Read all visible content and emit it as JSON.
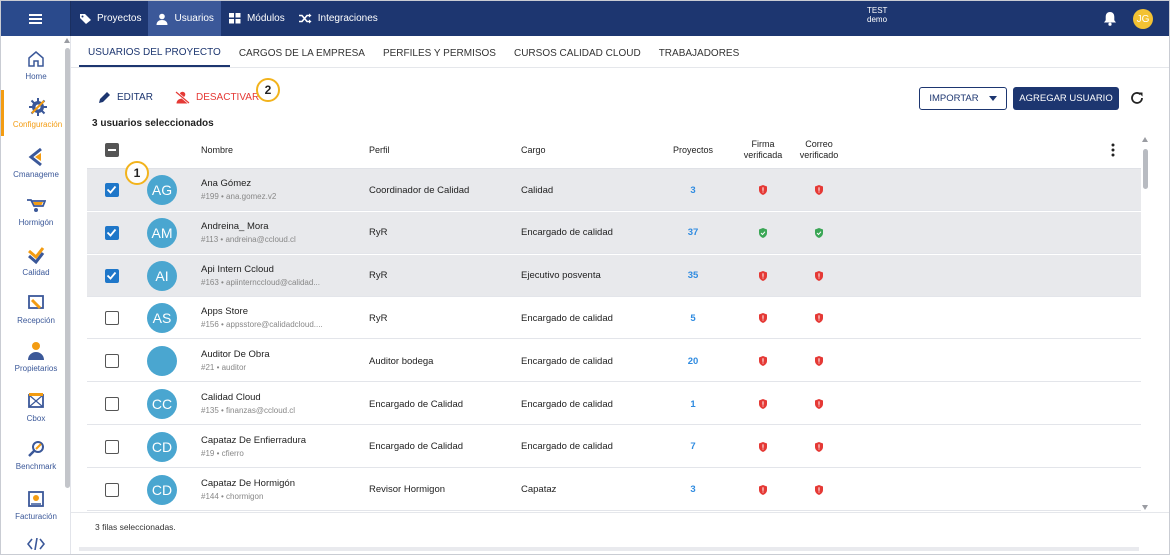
{
  "topbar": {
    "tabs": [
      {
        "label": "Proyectos",
        "icon": "tag-icon"
      },
      {
        "label": "Usuarios",
        "icon": "user-icon"
      },
      {
        "label": "Módulos",
        "icon": "grid-icon"
      },
      {
        "label": "Integraciones",
        "icon": "shuffle-icon"
      }
    ],
    "active_tab": "Usuarios",
    "env_line1": "TEST",
    "env_line2": "demo",
    "user_initials": "JG"
  },
  "sidebar": {
    "items": [
      {
        "label": "Home",
        "icon": "home-icon"
      },
      {
        "label": "Configuración",
        "icon": "settings-icon",
        "active": true
      },
      {
        "label": "Cmanageme",
        "icon": "cmanagement-icon"
      },
      {
        "label": "Hormigón",
        "icon": "wheelbarrow-icon"
      },
      {
        "label": "Calidad",
        "icon": "quality-check-icon"
      },
      {
        "label": "Recepción",
        "icon": "reception-icon"
      },
      {
        "label": "Propietarios",
        "icon": "owners-icon"
      },
      {
        "label": "Cbox",
        "icon": "cbox-icon"
      },
      {
        "label": "Benchmark",
        "icon": "benchmark-icon"
      },
      {
        "label": "Facturación",
        "icon": "billing-icon"
      }
    ]
  },
  "subtabs": [
    "USUARIOS DEL PROYECTO",
    "CARGOS DE LA EMPRESA",
    "PERFILES Y PERMISOS",
    "CURSOS CALIDAD CLOUD",
    "TRABAJADORES"
  ],
  "actions": {
    "edit_label": "EDITAR",
    "deactivate_label": "DESACTIVAR",
    "import_label": "IMPORTAR",
    "add_user_label": "AGREGAR USUARIO",
    "selection_summary": "3 usuarios seleccionados"
  },
  "badges": {
    "one": "1",
    "two": "2"
  },
  "table": {
    "columns": {
      "name": "Nombre",
      "profile": "Perfil",
      "role": "Cargo",
      "projects": "Proyectos",
      "signature": "Firma verificada",
      "email": "Correo verificado"
    },
    "rows": [
      {
        "initials": "AG",
        "name": "Ana Gómez",
        "sub": "#199 • ana.gomez.v2",
        "profile": "Coordinador de Calidad",
        "role": "Calidad",
        "projects": "3",
        "signature_ok": false,
        "email_ok": false,
        "selected": true
      },
      {
        "initials": "AM",
        "name": "Andreina_ Mora",
        "sub": "#113 • andreina@ccloud.cl",
        "profile": "RyR",
        "role": "Encargado de calidad",
        "projects": "37",
        "signature_ok": true,
        "email_ok": true,
        "selected": true
      },
      {
        "initials": "AI",
        "name": "Api Intern Ccloud",
        "sub": "#163 • apiinternccloud@calidad...",
        "profile": "RyR",
        "role": "Ejecutivo posventa",
        "projects": "35",
        "signature_ok": false,
        "email_ok": false,
        "selected": true
      },
      {
        "initials": "AS",
        "name": "Apps Store",
        "sub": "#156 • appsstore@calidadcloud....",
        "profile": "RyR",
        "role": "Encargado de calidad",
        "projects": "5",
        "signature_ok": false,
        "email_ok": false,
        "selected": false
      },
      {
        "initials": "",
        "name": "Auditor De Obra",
        "sub": "#21 • auditor",
        "profile": "Auditor bodega",
        "role": "Encargado de calidad",
        "projects": "20",
        "signature_ok": false,
        "email_ok": false,
        "selected": false
      },
      {
        "initials": "CC",
        "name": "Calidad Cloud",
        "sub": "#135 • finanzas@ccloud.cl",
        "profile": "Encargado de Calidad",
        "role": "Encargado de calidad",
        "projects": "1",
        "signature_ok": false,
        "email_ok": false,
        "selected": false
      },
      {
        "initials": "CD",
        "name": "Capataz De Enfierradura",
        "sub": "#19 • cfierro",
        "profile": "Encargado de Calidad",
        "role": "Encargado de calidad",
        "projects": "7",
        "signature_ok": false,
        "email_ok": false,
        "selected": false
      },
      {
        "initials": "CD",
        "name": "Capataz De Hormigón",
        "sub": "#144 • chormigon",
        "profile": "Revisor Hormigon",
        "role": "Capataz",
        "projects": "3",
        "signature_ok": false,
        "email_ok": false,
        "selected": false
      }
    ]
  },
  "footer": {
    "selected_rows": "3 filas seleccionadas."
  },
  "colors": {
    "primary": "#1d3670",
    "accent": "#f39c12",
    "danger": "#e53935",
    "success": "#3aa655",
    "avatar": "#4aa6d0",
    "link": "#2f8be0"
  }
}
